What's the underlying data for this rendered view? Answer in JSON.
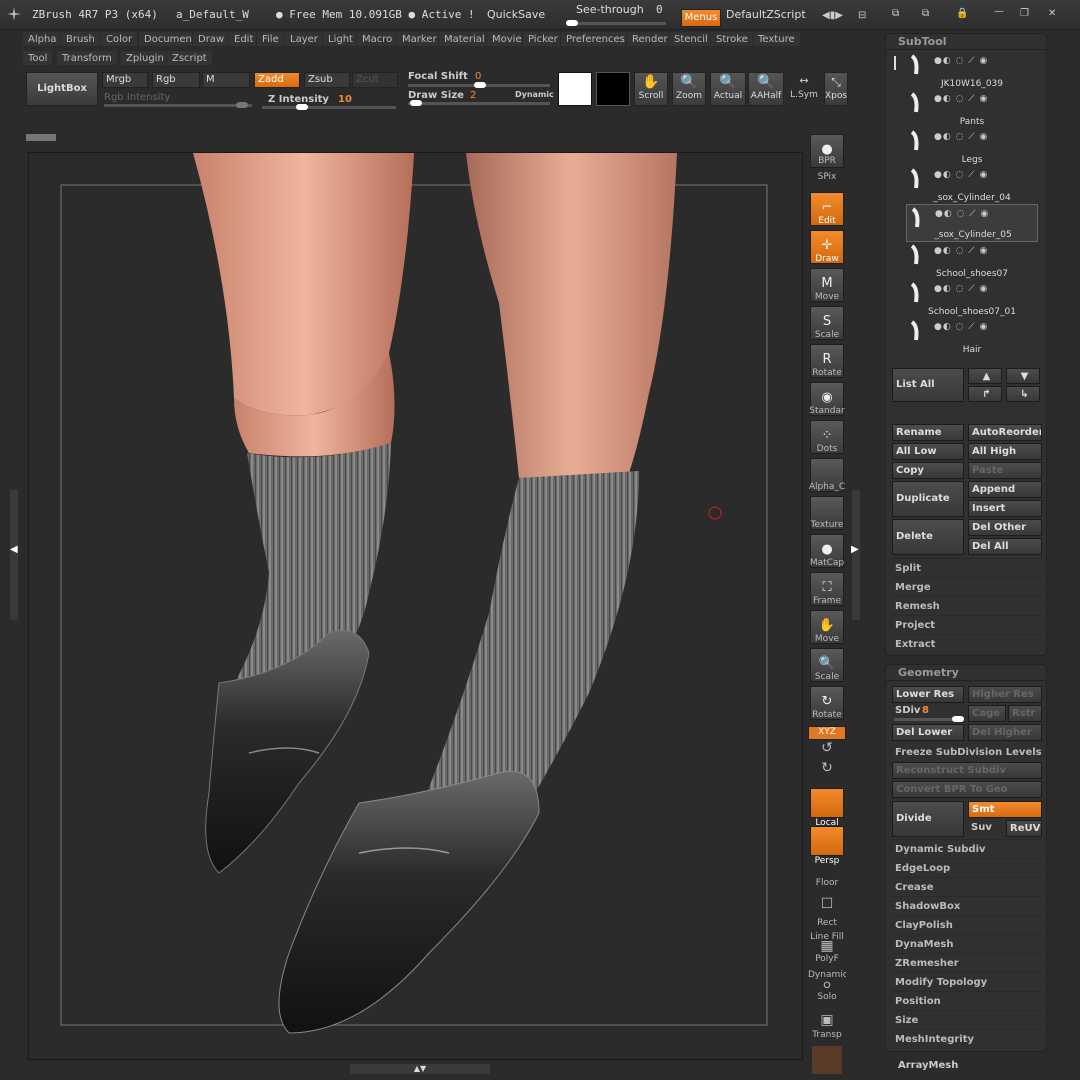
{
  "titlebar": {
    "app": "ZBrush 4R7 P3 (x64)",
    "doc": "a_Default_W",
    "mem": "● Free Mem 10.091GB ● Active !",
    "quicksave": "QuickSave",
    "see_through_label": "See-through",
    "see_through_value": "0",
    "menus": "Menus",
    "script": "DefaultZScript"
  },
  "menu_row1": [
    "Alpha",
    "Brush",
    "Color",
    "Document",
    "Draw",
    "Edit",
    "File",
    "Layer",
    "Light",
    "Macro",
    "Marker",
    "Material",
    "Movie",
    "Picker",
    "Preferences",
    "Render",
    "Stencil",
    "Stroke",
    "Texture"
  ],
  "menu_row2": [
    "Tool",
    "Transform",
    "Zplugin",
    "Zscript"
  ],
  "topshelf": {
    "lightbox": "LightBox",
    "mrgb": "Mrgb",
    "rgb": "Rgb",
    "m": "M",
    "zadd": "Zadd",
    "zsub": "Zsub",
    "zcut": "Zcut",
    "rgb_intensity": "Rgb Intensity",
    "z_intensity_label": "Z Intensity",
    "z_intensity_value": "10",
    "focal_shift_label": "Focal Shift",
    "focal_shift_value": "0",
    "draw_size_label": "Draw Size",
    "draw_size_value": "2",
    "dynamic": "Dynamic",
    "scroll": "Scroll",
    "zoom": "Zoom",
    "actual": "Actual",
    "aahalf": "AAHalf",
    "lsym": "L.Sym",
    "xpose": "Xpos"
  },
  "rightshelf": [
    {
      "label": "BPR",
      "name": "bpr-button",
      "orange": false
    },
    {
      "label": "Edit",
      "name": "edit-button",
      "orange": true
    },
    {
      "label": "Draw",
      "name": "draw-button",
      "orange": true
    },
    {
      "label": "Move",
      "name": "move-button",
      "orange": false
    },
    {
      "label": "Scale",
      "name": "scale-button",
      "orange": false
    },
    {
      "label": "Rotate",
      "name": "rotate-button",
      "orange": false
    },
    {
      "label": "Standar",
      "name": "standard-brush-button",
      "orange": false
    },
    {
      "label": "Dots",
      "name": "dots-stroke-button",
      "orange": false
    },
    {
      "label": "Alpha_C",
      "name": "alpha-button",
      "orange": false
    },
    {
      "label": "Texture",
      "name": "texture-button",
      "orange": false
    },
    {
      "label": "MatCap",
      "name": "matcap-button",
      "orange": false
    },
    {
      "label": "Frame",
      "name": "frame-button",
      "orange": false
    },
    {
      "label": "Move",
      "name": "move-view-button",
      "orange": false
    },
    {
      "label": "Scale",
      "name": "scale-view-button",
      "orange": false
    },
    {
      "label": "Rotate",
      "name": "rotate-view-button",
      "orange": false
    }
  ],
  "rightshelf2": {
    "spix": "SPix",
    "xyz": "XYZ",
    "local": "Local",
    "persp": "Persp",
    "dynamic": "Dynamic",
    "floor": "Floor",
    "rect": "Rect",
    "line_fill": "Line Fill",
    "polyf": "PolyF",
    "solo": "Solo",
    "transp": "Transp"
  },
  "subtool": {
    "title": "SubTool",
    "items": [
      {
        "name": "JK10W16_039"
      },
      {
        "name": "Pants"
      },
      {
        "name": "Legs"
      },
      {
        "name": "_sox_Cylinder_04"
      },
      {
        "name": "_sox_Cylinder_05"
      },
      {
        "name": "School_shoes07"
      },
      {
        "name": "School_shoes07_01"
      },
      {
        "name": "Hair"
      }
    ],
    "list_all": "List All",
    "rename": "Rename",
    "autoreorder": "AutoReorder",
    "all_low": "All Low",
    "all_high": "All High",
    "copy": "Copy",
    "paste": "Paste",
    "duplicate": "Duplicate",
    "append": "Append",
    "insert": "Insert",
    "delete": "Delete",
    "del_other": "Del Other",
    "del_all": "Del All",
    "split": "Split",
    "merge": "Merge",
    "remesh": "Remesh",
    "project": "Project",
    "extract": "Extract"
  },
  "geometry": {
    "title": "Geometry",
    "lower_res": "Lower Res",
    "higher_res": "Higher Res",
    "sdiv_label": "SDiv",
    "sdiv_value": "8",
    "cage": "Cage",
    "rstr": "Rstr",
    "del_lower": "Del Lower",
    "del_higher": "Del Higher",
    "freeze": "Freeze SubDivision Levels",
    "reconstruct": "Reconstruct Subdiv",
    "convert_bpr": "Convert BPR To Geo",
    "divide": "Divide",
    "smt": "Smt",
    "suv": "Suv",
    "reuv": "ReUV",
    "sections": [
      "Dynamic Subdiv",
      "EdgeLoop",
      "Crease",
      "ShadowBox",
      "ClayPolish",
      "DynaMesh",
      "ZRemesher",
      "Modify Topology",
      "Position",
      "Size",
      "MeshIntegrity"
    ],
    "arraymesh": "ArrayMesh"
  },
  "colors": {
    "accent": "#f08a30",
    "panel": "#303030",
    "bg": "#2b2b2b"
  }
}
